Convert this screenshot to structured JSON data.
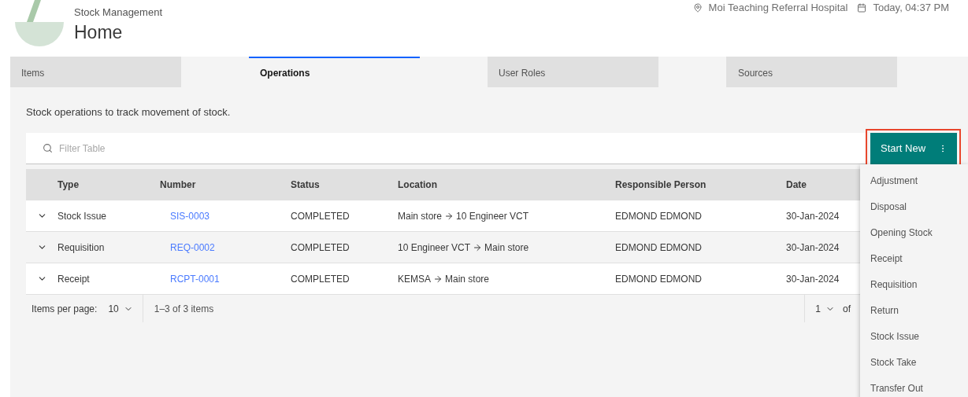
{
  "header": {
    "app_name": "Stock Management",
    "page_title": "Home",
    "location": "Moi Teaching Referral Hospital",
    "datetime": "Today, 04:37 PM"
  },
  "tabs": [
    {
      "label": "Items",
      "selected": false
    },
    {
      "label": "Operations",
      "selected": true
    },
    {
      "label": "User Roles",
      "selected": false
    },
    {
      "label": "Sources",
      "selected": false
    }
  ],
  "description": "Stock operations to track movement of stock.",
  "filter": {
    "placeholder": "Filter Table"
  },
  "start_button": {
    "label": "Start New",
    "menu_open": true
  },
  "menu": [
    "Adjustment",
    "Disposal",
    "Opening Stock",
    "Receipt",
    "Requisition",
    "Return",
    "Stock Issue",
    "Stock Take",
    "Transfer Out"
  ],
  "table": {
    "columns": [
      "Type",
      "Number",
      "Status",
      "Location",
      "Responsible Person",
      "Date"
    ],
    "rows": [
      {
        "type": "Stock Issue",
        "number": "SIS-0003",
        "status": "COMPLETED",
        "from": "Main store",
        "to": "10 Engineer VCT",
        "person": "EDMOND EDMOND",
        "date": "30-Jan-2024",
        "highlighted": false
      },
      {
        "type": "Requisition",
        "number": "REQ-0002",
        "status": "COMPLETED",
        "from": "10 Engineer VCT",
        "to": "Main store",
        "person": "EDMOND EDMOND",
        "date": "30-Jan-2024",
        "highlighted": true
      },
      {
        "type": "Receipt",
        "number": "RCPT-0001",
        "status": "COMPLETED",
        "from": "KEMSA",
        "to": "Main store",
        "person": "EDMOND EDMOND",
        "date": "30-Jan-2024",
        "highlighted": false
      }
    ]
  },
  "pagination": {
    "per_page_label": "Items per page:",
    "per_page": "10",
    "range": "1–3 of 3 items",
    "page": "1",
    "of_label": "of"
  }
}
